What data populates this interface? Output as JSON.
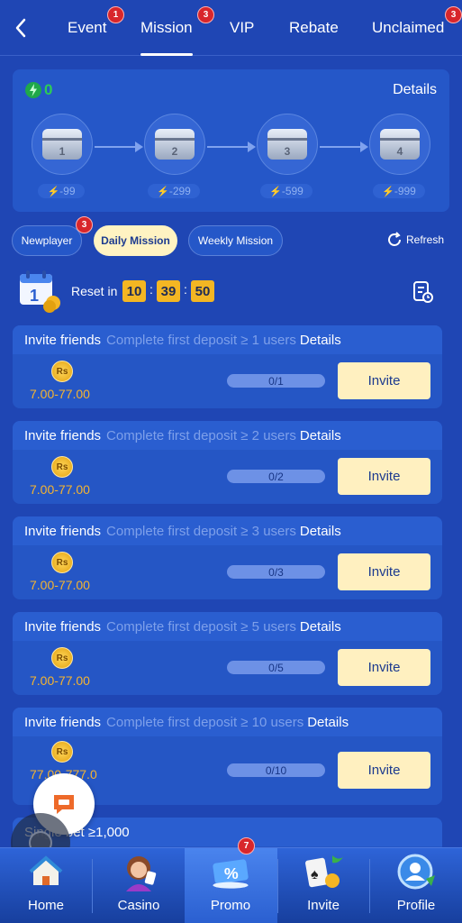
{
  "tabs": [
    {
      "label": "Event",
      "badge": "1"
    },
    {
      "label": "Mission",
      "badge": "3"
    },
    {
      "label": "VIP"
    },
    {
      "label": "Rebate"
    },
    {
      "label": "Unclaimed",
      "badge": "3"
    }
  ],
  "energy": {
    "value": "0",
    "details": "Details"
  },
  "chests": [
    {
      "num": "1",
      "cost": "-99"
    },
    {
      "num": "2",
      "cost": "-299"
    },
    {
      "num": "3",
      "cost": "-599"
    },
    {
      "num": "4",
      "cost": "-999"
    }
  ],
  "mission_tabs": [
    {
      "label": "Newplayer",
      "badge": "3"
    },
    {
      "label": "Daily Mission"
    },
    {
      "label": "Weekly Mission"
    }
  ],
  "refresh": "Refresh",
  "reset": {
    "label": "Reset in",
    "h": "10",
    "m": "39",
    "s": "50",
    "sep": ":"
  },
  "missions": [
    {
      "title": "Invite friends",
      "desc": "Complete first deposit ≥ 1 users",
      "details": "Details",
      "coin": "Rs",
      "reward": "7.00-77.00",
      "progress": "0/1",
      "button": "Invite"
    },
    {
      "title": "Invite friends",
      "desc": "Complete first deposit ≥ 2 users",
      "details": "Details",
      "coin": "Rs",
      "reward": "7.00-77.00",
      "progress": "0/2",
      "button": "Invite"
    },
    {
      "title": "Invite friends",
      "desc": "Complete first deposit ≥ 3 users",
      "details": "Details",
      "coin": "Rs",
      "reward": "7.00-77.00",
      "progress": "0/3",
      "button": "Invite"
    },
    {
      "title": "Invite friends",
      "desc": "Complete first deposit ≥ 5 users",
      "details": "Details",
      "coin": "Rs",
      "reward": "7.00-77.00",
      "progress": "0/5",
      "button": "Invite"
    },
    {
      "title": "Invite friends",
      "desc": "Complete first deposit ≥ 10 users",
      "details": "Details",
      "coin": "Rs",
      "reward": "77.00-777.0",
      "progress": "0/10",
      "button": "Invite"
    }
  ],
  "partial_card": {
    "title": "Single bet ≥1,000"
  },
  "bottom_nav": [
    {
      "label": "Home"
    },
    {
      "label": "Casino"
    },
    {
      "label": "Promo",
      "badge": "7"
    },
    {
      "label": "Invite"
    },
    {
      "label": "Profile"
    }
  ],
  "colors": {
    "background": "#1f46b4",
    "accent": "#f3b623",
    "badge": "#d8262b",
    "button": "#fff0c0"
  }
}
